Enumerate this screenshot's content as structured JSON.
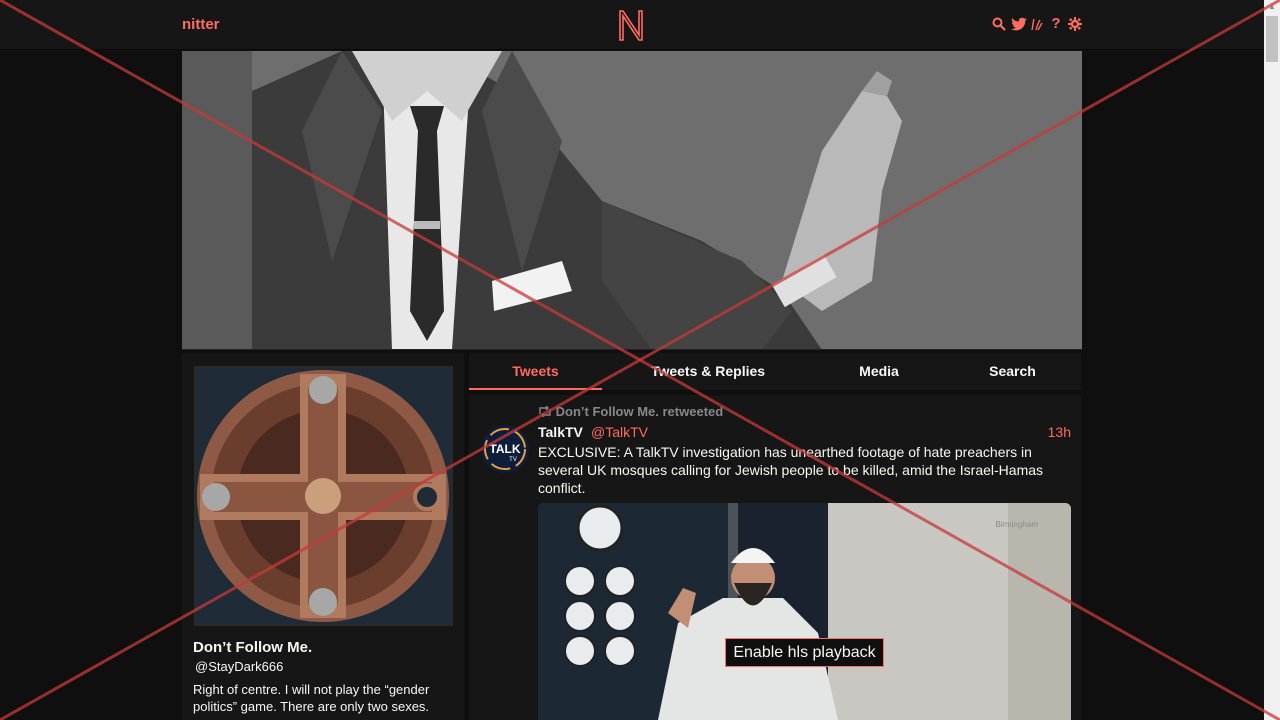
{
  "nav": {
    "logo_text": "nitter",
    "logo_mark": "N",
    "icons": [
      "search-icon",
      "twitter-bird-icon",
      "rss-icon",
      "help-icon",
      "gear-icon"
    ],
    "help_glyph": "?",
    "accent_color": "#ff6c60"
  },
  "profile": {
    "display_name": "Don’t Follow Me.",
    "handle": "@StayDark666",
    "bio": "Right of centre. I will not play the “gender politics” game. There are only two sexes."
  },
  "tabs": [
    {
      "label": "Tweets",
      "active": true
    },
    {
      "label": "Tweets & Replies",
      "active": false
    },
    {
      "label": "Media",
      "active": false
    },
    {
      "label": "Search",
      "active": false
    }
  ],
  "tweet": {
    "retweet_header": "Don’t Follow Me. retweeted",
    "author_name": "TalkTV",
    "author_handle": "@TalkTV",
    "time": "13h",
    "avatar_text": "TALK",
    "avatar_subtext": "TV",
    "text": "EXCLUSIVE: A TalkTV investigation has unearthed footage of hate preachers in several UK mosques calling for Jewish people to be killed, amid the Israel-Hamas conflict.",
    "media_watermark": "Birmingham",
    "hls_button": "Enable hls playback"
  }
}
